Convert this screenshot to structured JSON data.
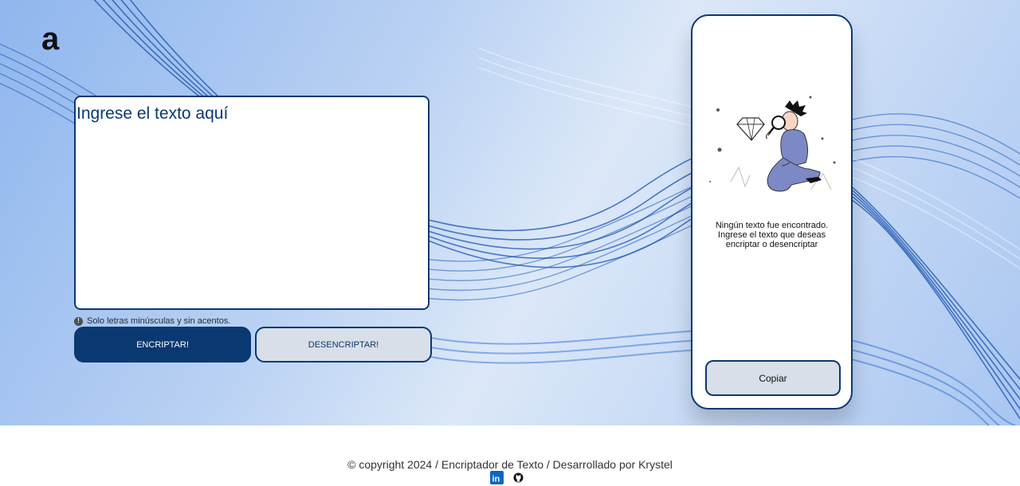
{
  "logo": {
    "icon": "alura-logo-icon",
    "glyph": "a"
  },
  "input": {
    "placeholder": "Ingrese el texto aquí"
  },
  "hint": {
    "icon": "info-icon",
    "glyph": "!",
    "text": "Solo letras minúsculas y sin acentos."
  },
  "buttons": {
    "encrypt_label": "ENCRIPTAR!",
    "decrypt_label": "DESENCRIPTAR!"
  },
  "result": {
    "illustration": "person-with-magnifying-glass-illustration",
    "message_lines": [
      "Ningún texto fue encontrado.",
      "Ingrese el texto que deseas",
      "encriptar o desencriptar"
    ],
    "copy_label": "Copiar"
  },
  "footer": {
    "copyright": "© copyright 2024 / Encriptador de Texto / Desarrollado por Krystel",
    "social": [
      {
        "icon": "linkedin-icon",
        "glyph": "in"
      },
      {
        "icon": "github-icon",
        "glyph": ""
      }
    ]
  },
  "colors": {
    "primary": "#0a3871",
    "secondary_button_bg": "#d8dfe8",
    "linkedin": "#0a66c2",
    "background_light": "#dce8f8",
    "background_mid": "#8fb6ee"
  }
}
